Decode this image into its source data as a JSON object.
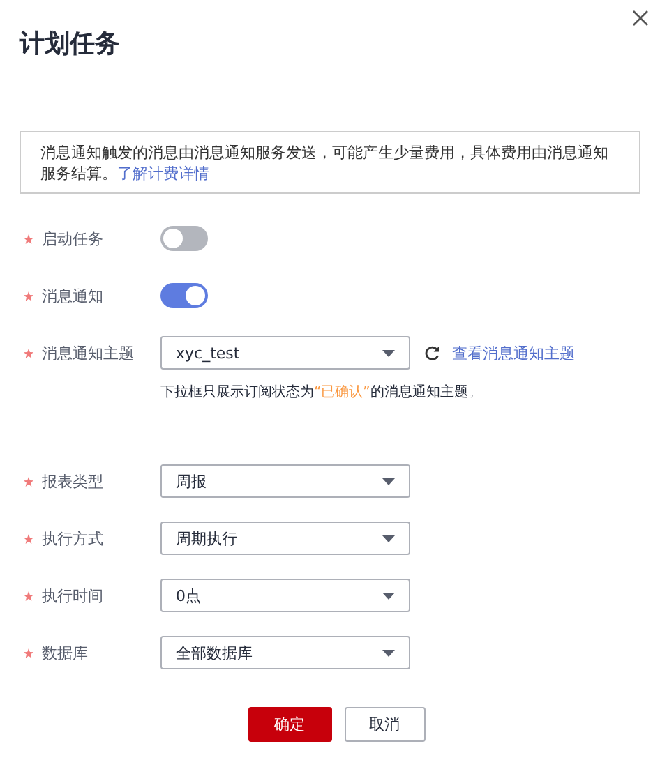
{
  "dialog": {
    "title": "计划任务"
  },
  "notice": {
    "text": "消息通知触发的消息由消息通知服务发送，可能产生少量费用，具体费用由消息通知服务结算。",
    "link": "了解计费详情"
  },
  "fields": [
    {
      "kind": "toggle",
      "label": "启动任务",
      "required": true,
      "on": false
    },
    {
      "kind": "toggle",
      "label": "消息通知",
      "required": true,
      "on": true
    },
    {
      "kind": "select",
      "label": "消息通知主题",
      "required": true,
      "value": "xyc_test",
      "refresh": true,
      "link": "查看消息通知主题",
      "hint": {
        "before": "下拉框只展示订阅状态为",
        "highlight": "“已确认”",
        "after": "的消息通知主题。"
      }
    },
    {
      "kind": "select",
      "label": "报表类型",
      "required": true,
      "value": "周报"
    },
    {
      "kind": "select",
      "label": "执行方式",
      "required": true,
      "value": "周期执行"
    },
    {
      "kind": "select",
      "label": "执行时间",
      "required": true,
      "value": "0点"
    },
    {
      "kind": "select",
      "label": "数据库",
      "required": true,
      "value": "全部数据库"
    }
  ],
  "buttons": [
    {
      "label": "确定",
      "kind": "primary"
    },
    {
      "label": "取消",
      "kind": "secondary"
    }
  ]
}
